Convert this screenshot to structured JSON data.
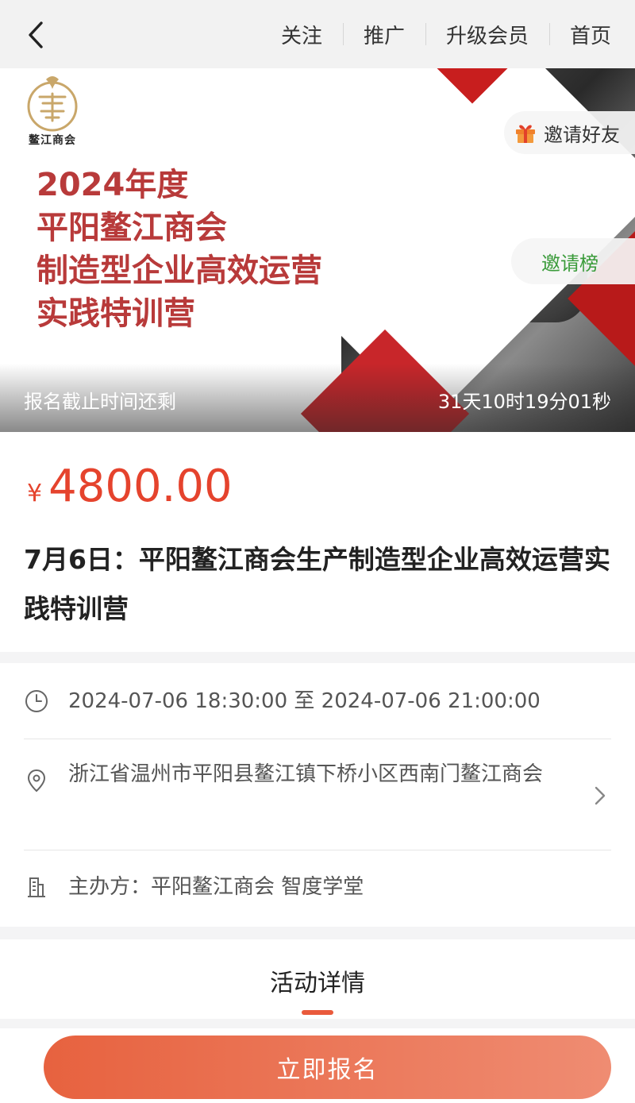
{
  "nav": {
    "links": [
      "关注",
      "推广",
      "升级会员",
      "首页"
    ]
  },
  "banner": {
    "logo_text": "鳌江商会",
    "title_lines": [
      "2024年度",
      "平阳鳌江商会",
      "制造型企业高效运营",
      "实践特训营"
    ],
    "invite_friends": "邀请好友",
    "invite_rank": "邀请榜",
    "countdown_label": "报名截止时间还剩",
    "countdown_time": "31天10时19分01秒"
  },
  "event": {
    "currency": "¥",
    "price": "4800.00",
    "title": "7月6日：平阳鳌江商会生产制造型企业高效运营实践特训营"
  },
  "details": {
    "time": "2024-07-06 18:30:00 至 2024-07-06 21:00:00",
    "address": "浙江省温州市平阳县鳌江镇下桥小区西南门鳌江商会",
    "organizer": "主办方：平阳鳌江商会 智度学堂"
  },
  "tabs": {
    "active": "活动详情"
  },
  "actions": {
    "signup": "立即报名"
  },
  "colors": {
    "accent": "#e5432d",
    "button_start": "#e7623f",
    "button_end": "#ef8c72",
    "rank_text": "#3a9b3a",
    "banner_title": "#b83a3a"
  }
}
